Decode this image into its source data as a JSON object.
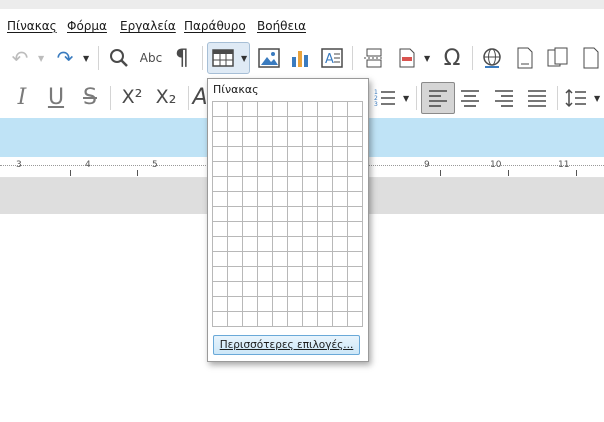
{
  "menu": {
    "items": [
      "Πίνακας",
      "Φόρμα",
      "Εργαλεία",
      "Παράθυρο",
      "Βοήθεια"
    ]
  },
  "toolbar1": {
    "icons": [
      "undo-icon",
      "redo-icon",
      "find-replace-icon",
      "spelling-icon",
      "formatting-marks-icon",
      "table-icon",
      "image-icon",
      "chart-icon",
      "text-box-icon",
      "page-break-icon",
      "field-icon",
      "special-character-icon",
      "hyperlink-icon",
      "footnote-icon",
      "comment-icon"
    ],
    "spell_label": "Abc",
    "pilcrow": "¶",
    "omega": "Ω"
  },
  "toolbar2": {
    "italic": "I",
    "underline": "U",
    "strike": "S",
    "superscript": "X²",
    "subscript": "X₂",
    "font_color": "A"
  },
  "ruler": {
    "numbers": [
      "3",
      "4",
      "5",
      "9",
      "10",
      "11"
    ]
  },
  "table_popup": {
    "title": "Πίνακας",
    "rows": 15,
    "columns": 10,
    "more_options": "Περισσότερες επιλογές..."
  }
}
